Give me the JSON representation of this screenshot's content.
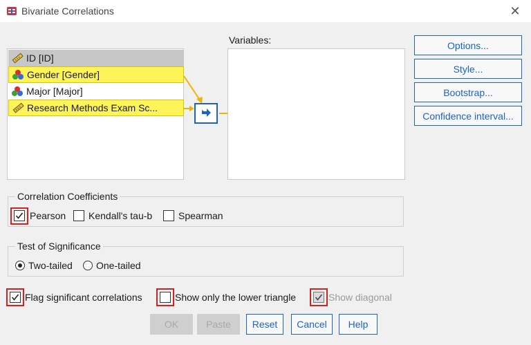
{
  "window": {
    "title": "Bivariate Correlations",
    "close_glyph": "✕"
  },
  "variables_label": "Variables:",
  "source_items": [
    {
      "label": "ID [ID]",
      "icon": "ruler-icon",
      "state": "selected"
    },
    {
      "label": "Gender [Gender]",
      "icon": "nominal-icon",
      "state": "highlighted"
    },
    {
      "label": "Major [Major]",
      "icon": "nominal-icon",
      "state": "normal"
    },
    {
      "label": "Research Methods Exam Sc...",
      "icon": "ruler-icon",
      "state": "highlighted"
    }
  ],
  "side_buttons": {
    "options": "Options...",
    "style": "Style...",
    "bootstrap": "Bootstrap...",
    "confidence": "Confidence interval..."
  },
  "correlation": {
    "title": "Correlation Coefficients",
    "pearson": {
      "label": "Pearson",
      "checked": true
    },
    "kendall": {
      "label": "Kendall's tau-b",
      "checked": false
    },
    "spearman": {
      "label": "Spearman",
      "checked": false
    }
  },
  "significance": {
    "title": "Test of Significance",
    "two_tailed": {
      "label": "Two-tailed",
      "selected": true
    },
    "one_tailed": {
      "label": "One-tailed",
      "selected": false
    }
  },
  "flags": {
    "flag_significant": {
      "label": "Flag significant correlations",
      "checked": true
    },
    "lower_triangle": {
      "label": "Show only the lower triangle",
      "checked": false
    },
    "show_diagonal": {
      "label": "Show diagonal",
      "checked": true,
      "disabled": true
    }
  },
  "footer": {
    "ok": "OK",
    "paste": "Paste",
    "reset": "Reset",
    "cancel": "Cancel",
    "help": "Help"
  },
  "colors": {
    "accent": "#1b63c6",
    "highlight": "#fdf45a",
    "arrow": "#f0b400",
    "annotation": "#d42020"
  }
}
